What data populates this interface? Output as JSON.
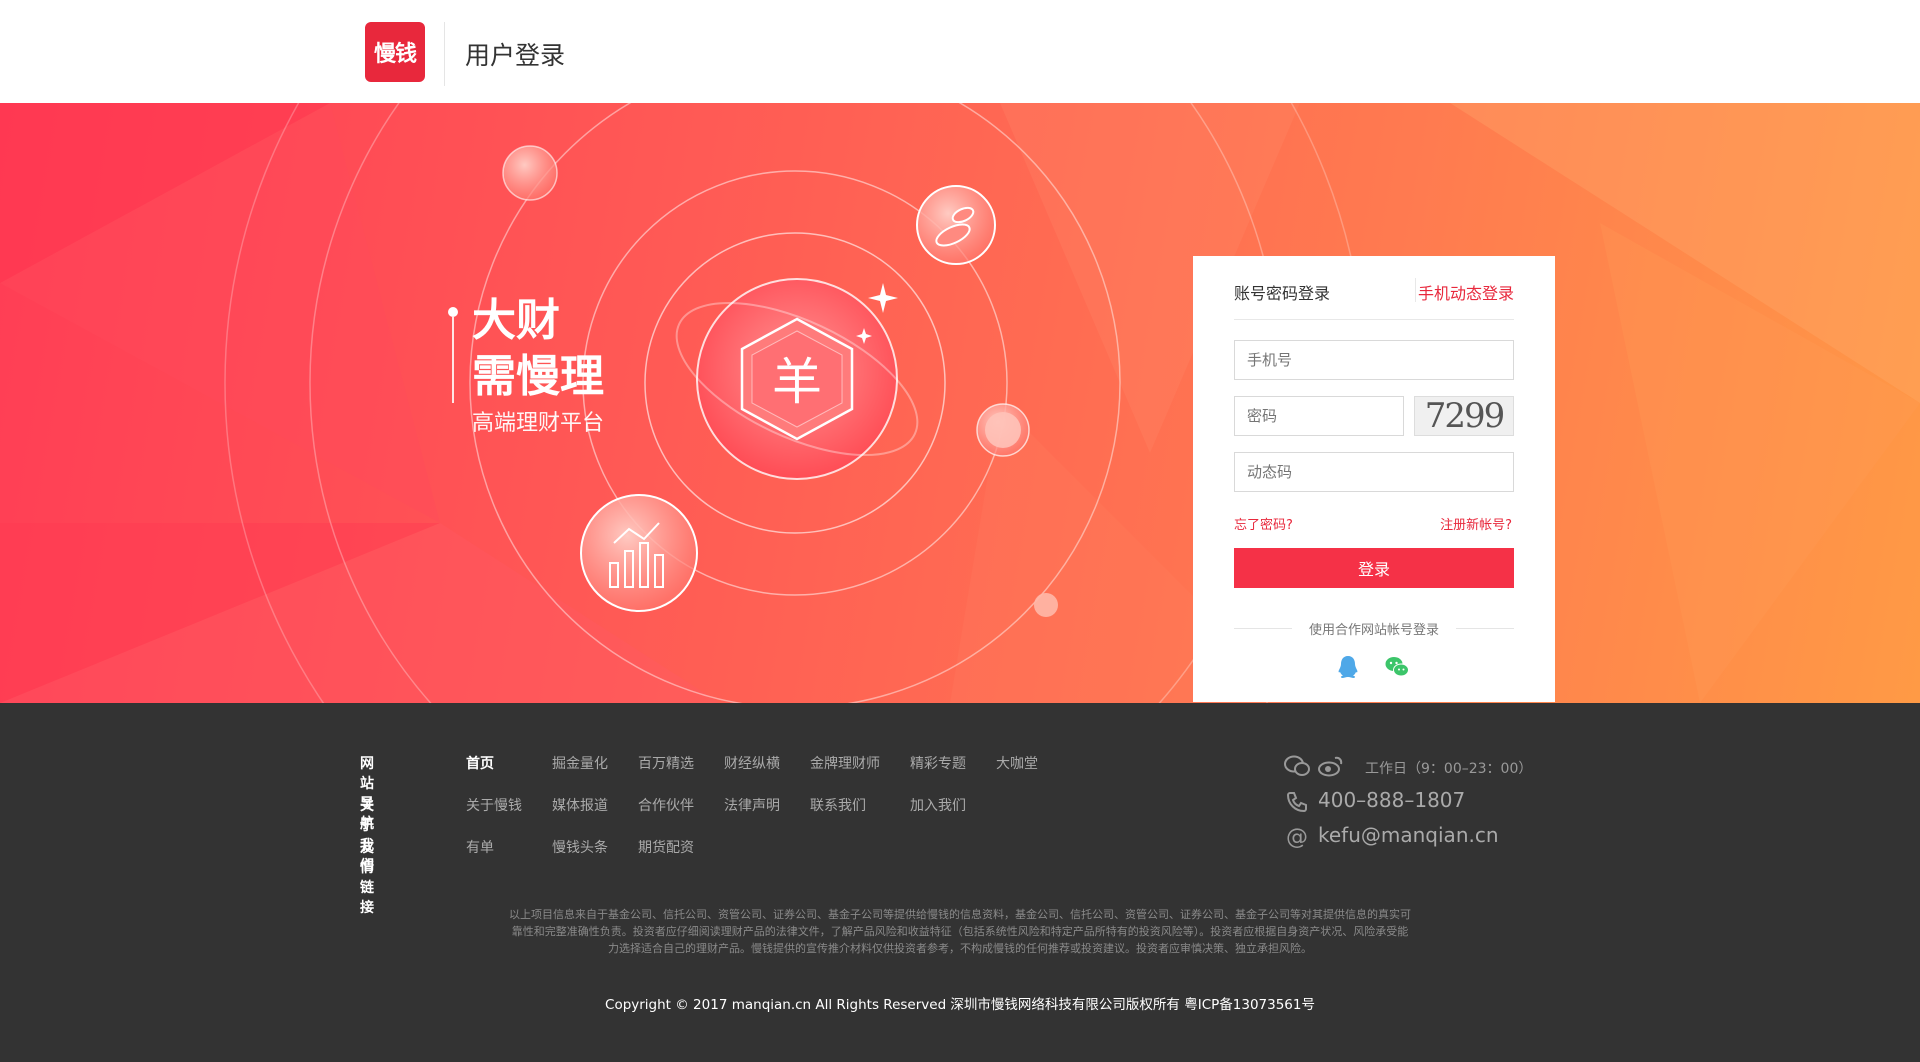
{
  "header": {
    "logo_text": "慢钱",
    "title": "用户登录"
  },
  "hero": {
    "slogan_line1": "大财",
    "slogan_line2": "需慢理",
    "slogan_sub": "高端理财平台",
    "center_symbol": "羊"
  },
  "login": {
    "tab_account": "账号密码登录",
    "tab_phone": "手机动态登录",
    "phone_placeholder": "手机号",
    "password_placeholder": "密码",
    "captcha_text": "7299",
    "dynamic_code_placeholder": "动态码",
    "forgot_password": "忘了密码?",
    "register": "注册新帐号?",
    "login_button": "登录",
    "partner_login_label": "使用合作网站帐号登录",
    "social_icons": [
      "qq-icon",
      "wechat-icon"
    ],
    "accent_color": "#e8283c"
  },
  "footer": {
    "nav": [
      {
        "heading": "网站导航",
        "items": [
          "首页",
          "掘金量化",
          "百万精选",
          "财经纵横",
          "金牌理财师",
          "精彩专题",
          "大咖堂"
        ]
      },
      {
        "heading": "关于我们",
        "items": [
          "关于慢钱",
          "媒体报道",
          "合作伙伴",
          "法律声明",
          "联系我们",
          "加入我们"
        ]
      },
      {
        "heading": "友情链接",
        "items": [
          "有单",
          "慢钱头条",
          "期货配资"
        ]
      }
    ],
    "hours": "工作日（9：00–23：00）",
    "phone": "400–888–1807",
    "email": "kefu@manqian.cn",
    "disclaimer_lines": [
      "以上项目信息来自于基金公司、信托公司、资管公司、证券公司、基金子公司等提供给慢钱的信息资料，基金公司、信托公司、资管公司、证券公司、基金子公司等对其提供信息的真实可",
      "靠性和完整准确性负责。投资者应仔细阅读理财产品的法律文件，了解产品风险和收益特征（包括系统性风险和特定产品所特有的投资风险等）。投资者应根据自身资产状况、风险承受能",
      "力选择适合自己的理财产品。慢钱提供的宣传推介材料仅供投资者参考，不构成慢钱的任何推荐或投资建议。投资者应审慎决策、独立承担风险。"
    ],
    "copyright": "Copyright © 2017 manqian.cn All Rights Reserved 深圳市慢钱网络科技有限公司版权所有  粤ICP备13073561号"
  }
}
